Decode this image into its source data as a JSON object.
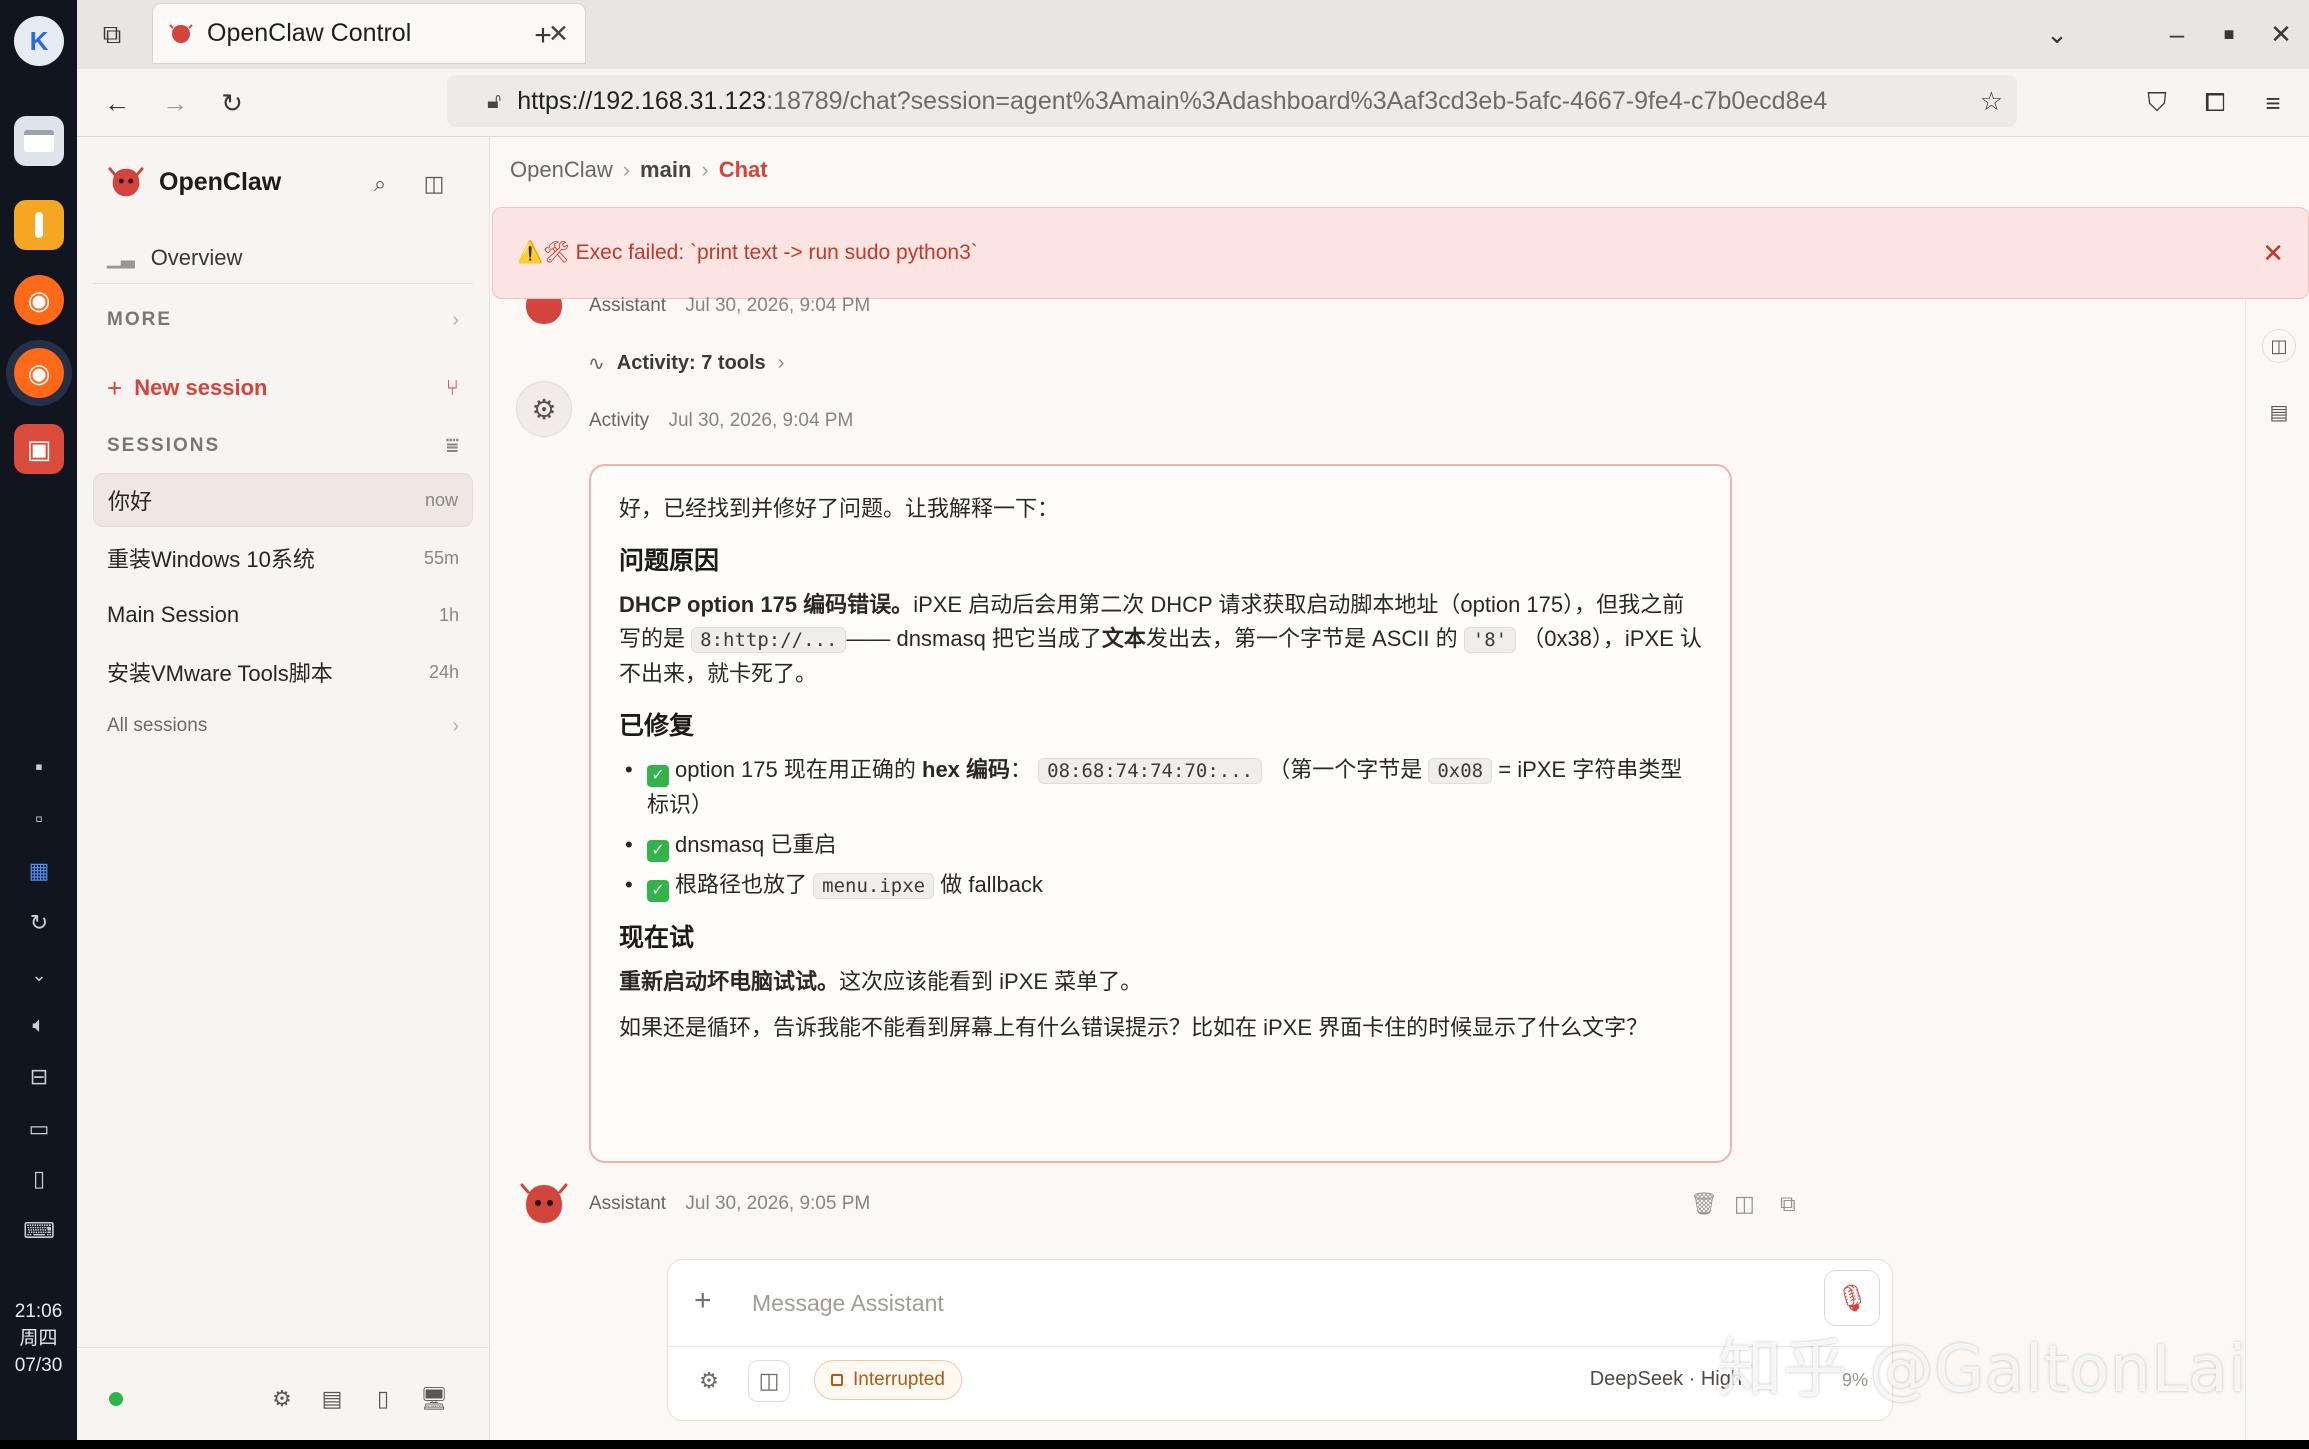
{
  "os": {
    "clock": {
      "time": "21:06",
      "weekday": "周四",
      "date": "07/30"
    }
  },
  "browser": {
    "tab_title": "OpenClaw Control",
    "url_host": "https://192.168.31.123",
    "url_rest": ":18789/chat?session=agent%3Amain%3Adashboard%3Aaf3cd3eb-5afc-4667-9fe4-c7b0ecd8e4"
  },
  "sidebar": {
    "brand": "OpenClaw",
    "overview": "Overview",
    "more_label": "MORE",
    "new_session": "New session",
    "sessions_label": "SESSIONS",
    "sessions": [
      {
        "title": "你好",
        "age": "now"
      },
      {
        "title": "重装Windows 10系统",
        "age": "55m"
      },
      {
        "title": "Main Session",
        "age": "1h"
      },
      {
        "title": "安装VMware Tools脚本",
        "age": "24h"
      }
    ],
    "all_sessions": "All sessions"
  },
  "breadcrumb": {
    "root": "OpenClaw",
    "mid": "main",
    "current": "Chat"
  },
  "error": {
    "message": "⚠️🛠 Exec failed: `print text -> run sudo python3`"
  },
  "messages": {
    "assistant_top": {
      "author": "Assistant",
      "time": "Jul 30, 2026, 9:04 PM"
    },
    "activity_toggle": "Activity: 7 tools",
    "activity": {
      "author": "Activity",
      "time": "Jul 30, 2026, 9:04 PM"
    },
    "assistant_bottom": {
      "author": "Assistant",
      "time": "Jul 30, 2026, 9:05 PM"
    }
  },
  "answer": {
    "intro": "好，已经找到并修好了问题。让我解释一下：",
    "h1": "问题原因",
    "cause_bold": "DHCP option 175 编码错误。",
    "cause_1": "iPXE 启动后会用第二次 DHCP 请求获取启动脚本地址（option 175），但我之前写的是",
    "cause_code1": "8:http://...",
    "cause_2": "—— dnsmasq 把它当成了",
    "cause_bold2": "文本",
    "cause_3": "发出去，第一个字节是 ASCII 的",
    "cause_code2": "'8'",
    "cause_4": "（0x38），iPXE 认不出来，就卡死了。",
    "h2": "已修复",
    "fix1_a": "option 175 现在用正确的",
    "fix1_bold": "hex 编码",
    "fix1_b": "：",
    "fix1_code": "08:68:74:74:70:...",
    "fix1_c": "（第一个字节是",
    "fix1_code2": "0x08",
    "fix1_d": "= iPXE 字符串类型标识）",
    "fix2": "dnsmasq 已重启",
    "fix3_a": "根路径也放了",
    "fix3_code": "menu.ipxe",
    "fix3_b": "做 fallback",
    "h3": "现在试",
    "try_bold": "重新启动坏电脑试试。",
    "try_rest": "这次应该能看到 iPXE 菜单了。",
    "closing": "如果还是循环，告诉我能不能看到屏幕上有什么错误提示？比如在 iPXE 界面卡住的时候显示了什么文字？"
  },
  "composer": {
    "placeholder": "Message Assistant",
    "status_pill": "Interrupted",
    "model": "DeepSeek · High",
    "context_pct": "9%"
  },
  "watermark": "知乎 @GaltonLai",
  "colors": {
    "accent": "#d2453c",
    "error_bg": "#fbe4e2",
    "status_ok": "#2fb34e"
  }
}
